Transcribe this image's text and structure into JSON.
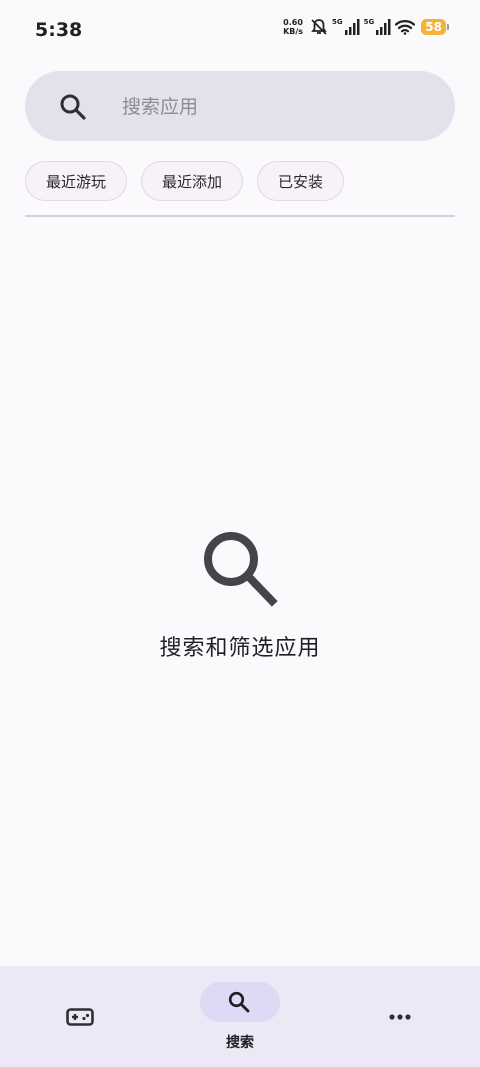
{
  "status_bar": {
    "time": "5:38",
    "net_speed_value": "0.60",
    "net_speed_unit": "KB/s",
    "signal1_label": "5G",
    "signal2_label": "5G",
    "battery": "58",
    "battery_color": "#f3b33a"
  },
  "search": {
    "placeholder": "搜索应用"
  },
  "chips": [
    {
      "label": "最近游玩"
    },
    {
      "label": "最近添加"
    },
    {
      "label": "已安装"
    }
  ],
  "empty_state": {
    "icon": "search-icon",
    "text": "搜索和筛选应用"
  },
  "bottom_nav": {
    "items": [
      {
        "icon": "gamepad-icon",
        "label": "",
        "selected": false
      },
      {
        "icon": "search-icon",
        "label": "搜索",
        "selected": true
      },
      {
        "icon": "more-icon",
        "label": "",
        "selected": false
      }
    ],
    "accent_color": "#dcdaf4"
  }
}
